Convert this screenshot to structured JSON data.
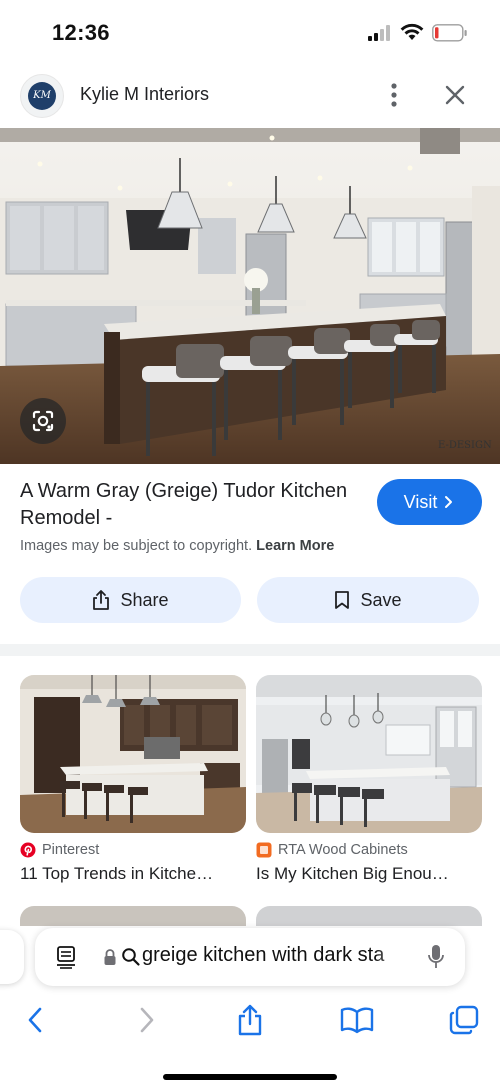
{
  "status_bar": {
    "time": "12:36"
  },
  "source": {
    "name": "Kylie M Interiors",
    "avatar_text": "KM"
  },
  "image": {
    "watermark": "E-DESIGN"
  },
  "result": {
    "title": "A Warm Gray (Greige) Tudor Kitchen Remodel -",
    "visit_label": "Visit",
    "copyright_text": "Images may be subject to copyright.",
    "learn_more_label": "Learn More",
    "share_label": "Share",
    "save_label": "Save"
  },
  "related": [
    {
      "source": "Pinterest",
      "title": "11 Top Trends in Kitche…"
    },
    {
      "source": "RTA Wood Cabinets",
      "title": "Is My Kitchen Big Enou…"
    }
  ],
  "browser": {
    "url_text": "greige kitchen with dark sta"
  },
  "colors": {
    "accent": "#1a73e8",
    "chip_bg": "#e8f0fe",
    "pinterest": "#e60023",
    "rta": "#f26b21"
  },
  "icons": {
    "status": [
      "signal-icon",
      "wifi-icon",
      "battery-icon"
    ],
    "header": [
      "more-vert-icon",
      "close-icon"
    ],
    "toolbar": [
      "back-icon",
      "forward-icon",
      "share-icon",
      "bookmarks-icon",
      "tabs-icon"
    ]
  }
}
